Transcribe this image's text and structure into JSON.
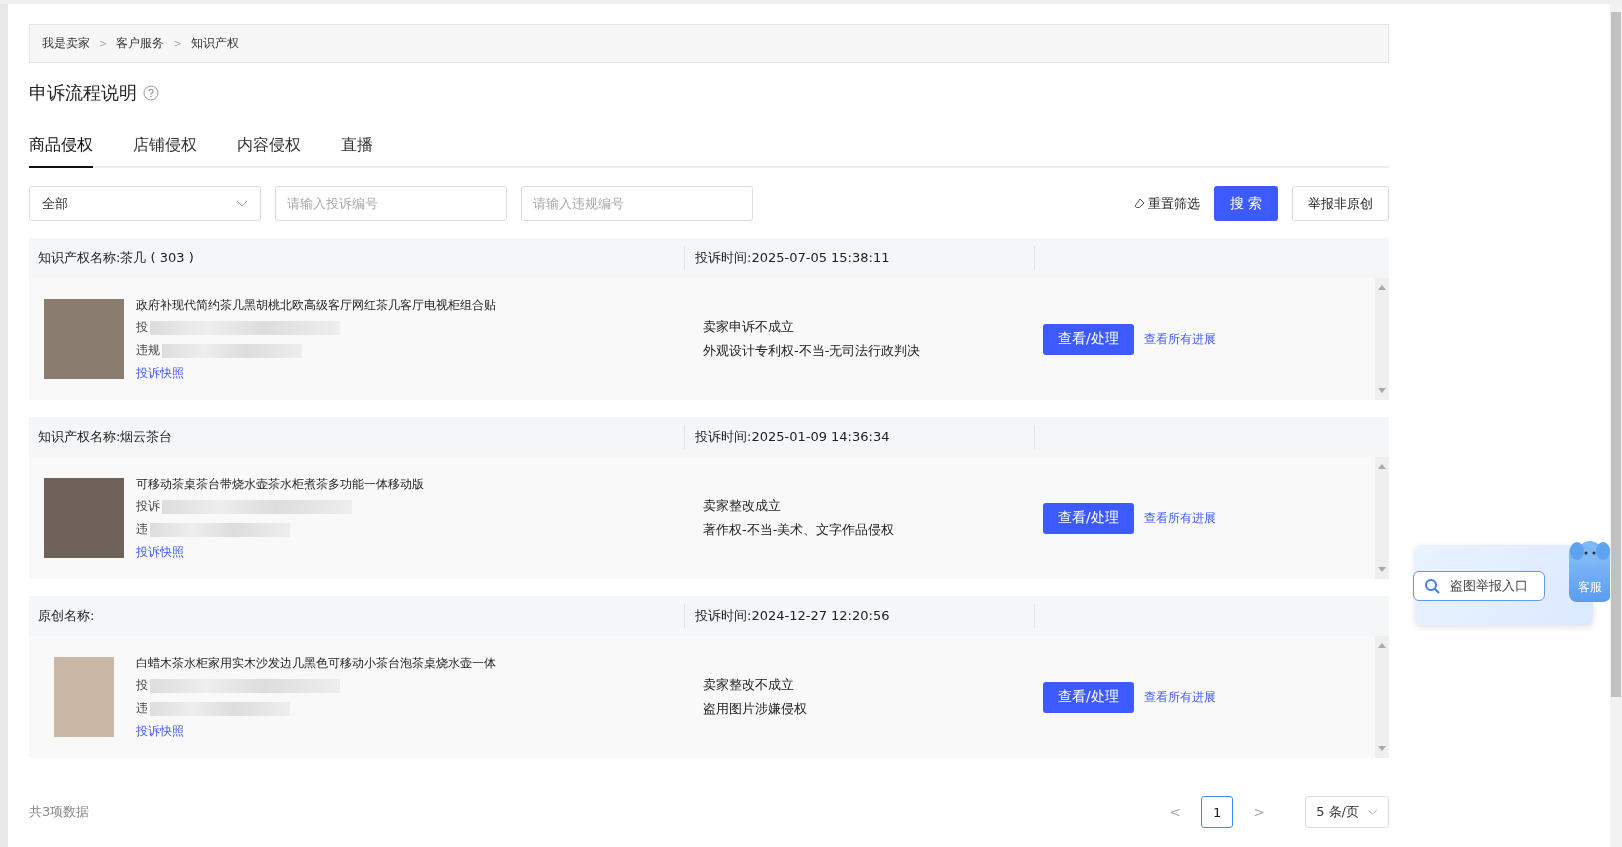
{
  "breadcrumb": [
    "我是卖家",
    "客户服务",
    "知识产权"
  ],
  "breadcrumb_separator": ">",
  "page_title": "申诉流程说明",
  "tabs": [
    {
      "label": "商品侵权",
      "selected": true
    },
    {
      "label": "店铺侵权",
      "selected": false
    },
    {
      "label": "内容侵权",
      "selected": false
    },
    {
      "label": "直播",
      "selected": false
    }
  ],
  "filters": {
    "type_select": {
      "value": "全部"
    },
    "complaint_no": {
      "placeholder": "请输入投诉编号"
    },
    "violation_no": {
      "placeholder": "请输入违规编号"
    },
    "reset": "重置筛选",
    "search": "搜 索",
    "report": "举报非原创"
  },
  "records": [
    {
      "ip_name": "知识产权名称:茶几 ( 303 )",
      "complaint_time": "投诉时间:2025-07-05 15:38:11",
      "product_title": "政府补现代简约茶几黑胡桃北欧高级客厅网红茶几客厅电视柜组合贴",
      "line_1": "投",
      "line_2": "违规",
      "snapshot": "投诉快照",
      "status": "卖家申诉不成立",
      "reason": "外观设计专利权-不当-无司法行政判决",
      "action": "查看/处理",
      "progress": "查看所有进展"
    },
    {
      "ip_name": "知识产权名称:烟云茶台",
      "complaint_time": "投诉时间:2025-01-09 14:36:34",
      "product_title": "可移动茶桌茶台带烧水壶茶水柜煮茶多功能一体移动版",
      "line_1": "投诉",
      "line_2": "违",
      "snapshot": "投诉快照",
      "status": "卖家整改成立",
      "reason": "著作权-不当-美术、文字作品侵权",
      "action": "查看/处理",
      "progress": "查看所有进展"
    },
    {
      "ip_name": "原创名称:",
      "complaint_time": "投诉时间:2024-12-27 12:20:56",
      "product_title": "白蜡木茶水柜家用实木沙发边几黑色可移动小茶台泡茶桌烧水壶一体",
      "line_1": "投",
      "line_2": "违",
      "snapshot": "投诉快照",
      "status": "卖家整改不成立",
      "reason": "盗用图片涉嫌侵权",
      "action": "查看/处理",
      "progress": "查看所有进展"
    }
  ],
  "total": "共3项数据",
  "pagination": {
    "pages": [
      {
        "label": "1",
        "selected": true
      }
    ],
    "prev": "<",
    "next": ">",
    "page_size": "5 条/页"
  },
  "floating_widget": {
    "search_label": "盗图举报入口",
    "service_label": "客服"
  }
}
